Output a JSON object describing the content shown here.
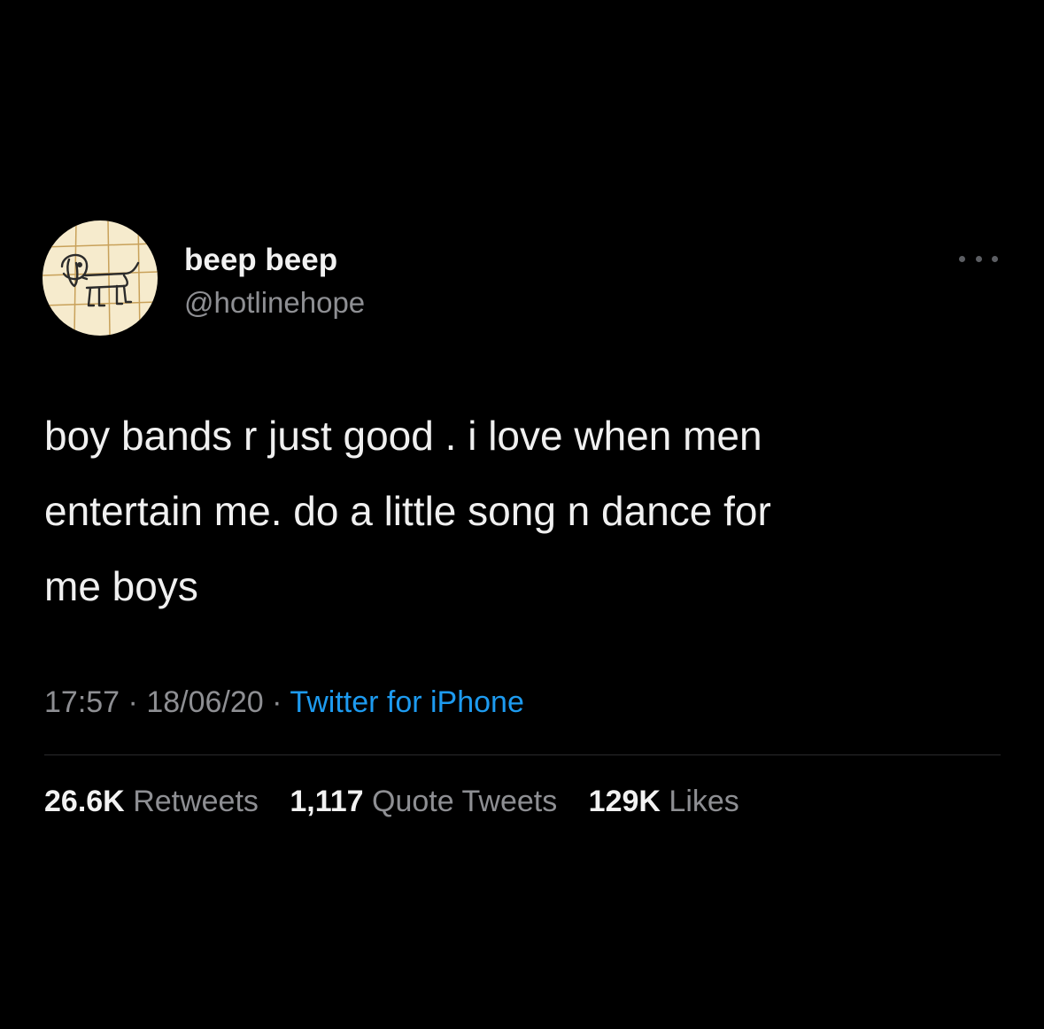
{
  "author": {
    "display_name": "beep beep",
    "handle": "@hotlinehope",
    "avatar_icon": "dog-drawing-avatar"
  },
  "tweet": {
    "text": "boy bands r just good . i love when men\nentertain me. do a little song n dance for\nme boys",
    "time": "17:57",
    "separator": "·",
    "date": "18/06/20",
    "source": "Twitter for iPhone"
  },
  "stats": {
    "retweets_count": "26.6K",
    "retweets_label": "Retweets",
    "quotes_count": "1,117",
    "quotes_label": "Quote Tweets",
    "likes_count": "129K",
    "likes_label": "Likes"
  },
  "colors": {
    "background": "#000000",
    "link": "#1d9bf0",
    "muted": "#8e8f93",
    "avatar_bg": "#f6ebcd"
  },
  "icons": {
    "more": "more-dots-icon"
  }
}
